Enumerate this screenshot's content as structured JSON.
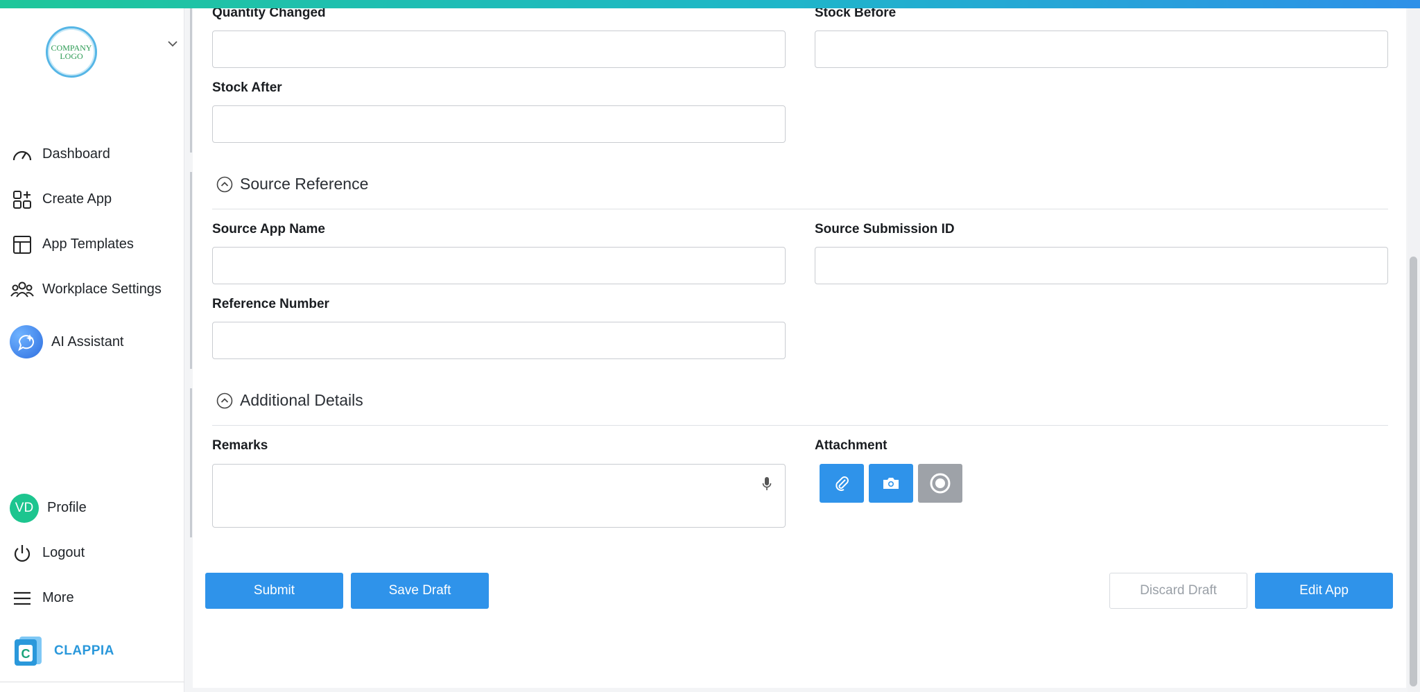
{
  "sidebar": {
    "logo_text_line1": "COMPANY",
    "logo_text_line2": "LOGO",
    "nav": [
      {
        "label": "Dashboard",
        "icon": "gauge-icon"
      },
      {
        "label": "Create App",
        "icon": "grid-plus-icon"
      },
      {
        "label": "App Templates",
        "icon": "template-layout-icon"
      },
      {
        "label": "Workplace Settings",
        "icon": "users-group-icon"
      },
      {
        "label": "AI Assistant",
        "icon": "ai-chat-sparkle-icon"
      }
    ],
    "profile": {
      "initials": "VD",
      "label": "Profile"
    },
    "logout_label": "Logout",
    "more_label": "More",
    "brand_name": "CLAPPIA"
  },
  "form": {
    "quantity_changed": {
      "label": "Quantity Changed",
      "value": ""
    },
    "stock_before": {
      "label": "Stock Before",
      "value": ""
    },
    "stock_after": {
      "label": "Stock After",
      "value": ""
    },
    "source_reference_title": "Source Reference",
    "source_app_name": {
      "label": "Source App Name",
      "value": ""
    },
    "source_submission_id": {
      "label": "Source Submission ID",
      "value": ""
    },
    "reference_number": {
      "label": "Reference Number",
      "value": ""
    },
    "additional_details_title": "Additional Details",
    "remarks": {
      "label": "Remarks",
      "value": ""
    },
    "attachment_label": "Attachment"
  },
  "actions": {
    "submit": "Submit",
    "save_draft": "Save Draft",
    "discard_draft": "Discard Draft",
    "edit_app": "Edit App"
  },
  "colors": {
    "primary": "#2f93ea",
    "disabled_gray": "#9ea2a8",
    "profile_avatar": "#1dc58f",
    "brand": "#2a98db"
  }
}
